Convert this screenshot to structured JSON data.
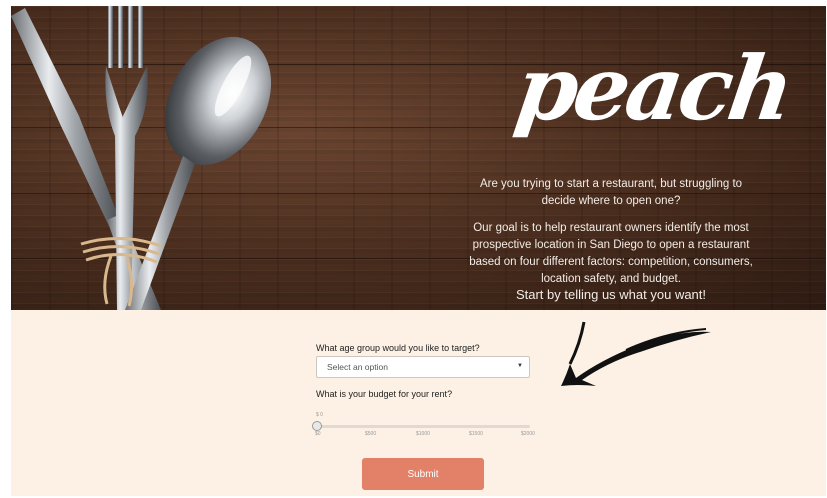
{
  "hero": {
    "brand": "peach",
    "question": "Are you trying to start a restaurant, but struggling to decide where to open one?",
    "goal": "Our goal is to help restaurant owners identify the most prospective location in San Diego to open a restaurant based on four different factors: competition, consumers, location safety, and budget.",
    "cta": "Start by telling us what you want!"
  },
  "form": {
    "age_label": "What age group would you like to target?",
    "age_select_value": "Select an option",
    "budget_label": "What is your budget for your rent?",
    "budget_current": "$ 0",
    "budget_value": 0,
    "budget_ticks": [
      "$0",
      "$500",
      "$1000",
      "$1500",
      "$2000"
    ],
    "submit_label": "Submit"
  },
  "colors": {
    "accent": "#e38068",
    "form_background": "#fdf1e5"
  },
  "icons": {
    "select_caret": "chevron-down-icon",
    "arrow": "brush-arrow-icon"
  }
}
